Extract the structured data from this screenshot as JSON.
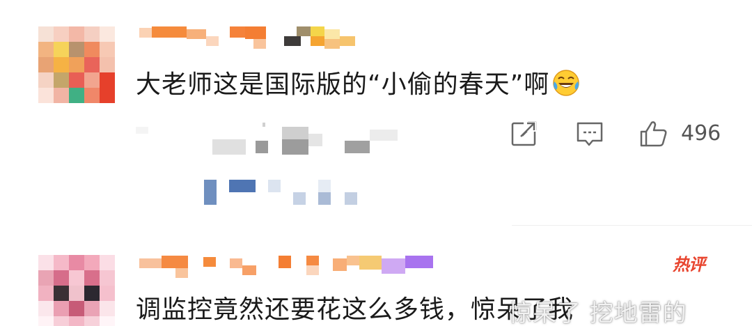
{
  "comments": [
    {
      "text": "大老师这是国际版的“小偷的春天”啊",
      "emoji": "laughing-crying-emoji",
      "actions": {
        "share_icon": "share-icon",
        "comment_icon": "comment-icon",
        "like_icon": "thumbs-up-icon",
        "like_count": "496"
      }
    },
    {
      "text": "调监控竟然还要花这么多钱，惊呆了我",
      "badge": "热评"
    }
  ],
  "watermark": "惊呆了 挖地雷的",
  "colors": {
    "text": "#1a1a1a",
    "icon": "#666666",
    "hot_badge": "#e8452f"
  }
}
